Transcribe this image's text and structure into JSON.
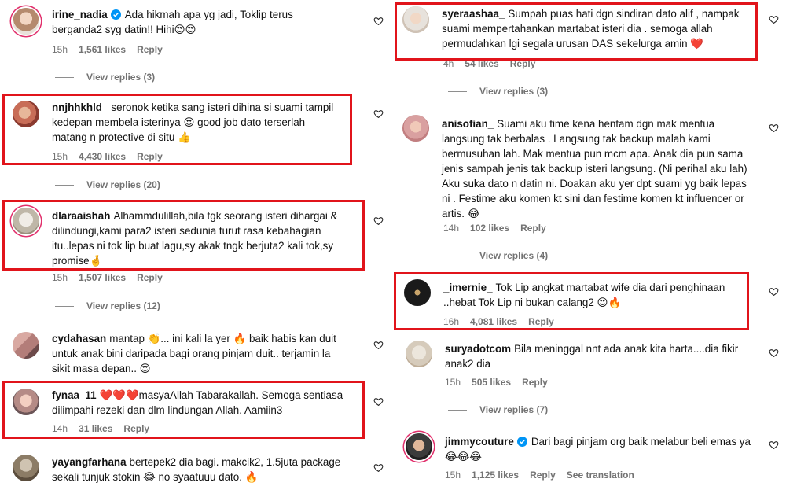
{
  "left": [
    {
      "user": "irine_nadia",
      "verified": true,
      "text": "Ada hikmah apa yg jadi, Toklip terus berganda2 syg datin!! Hihi😍😍",
      "time": "15h",
      "likes": "1,561 likes",
      "reply": "Reply",
      "view_replies": "View replies (3)"
    },
    {
      "user": "nnjhhkhld_",
      "verified": false,
      "text": "seronok ketika sang isteri dihina si suami tampil kedepan membela isterinya 😍 good job dato terserlah matang n protective di situ 👍",
      "time": "15h",
      "likes": "4,430 likes",
      "reply": "Reply",
      "view_replies": "View replies (20)"
    },
    {
      "user": "dlaraaishah",
      "verified": false,
      "text": "Alhammdulillah,bila tgk seorang isteri dihargai & dilindungi,kami para2 isteri sedunia turut rasa kebahagian itu..lepas ni tok lip buat lagu,sy akak tngk berjuta2 kali tok,sy promise🤞",
      "time": "15h",
      "likes": "1,507 likes",
      "reply": "Reply",
      "view_replies": "View replies (12)"
    },
    {
      "user": "cydahasan",
      "verified": false,
      "text": "mantap 👏... ini kali la yer 🔥 baik habis kan duit untuk anak bini daripada bagi orang pinjam duit.. terjamin la sikit masa depan.. 😍",
      "time": "",
      "likes": "",
      "reply": "",
      "view_replies": ""
    },
    {
      "user": "fynaa_11",
      "verified": false,
      "text": "❤️❤️❤️masyaAllah Tabarakallah. Semoga sentiasa dilimpahi rezeki dan dlm lindungan Allah. Aamiin3",
      "time": "14h",
      "likes": "31 likes",
      "reply": "Reply",
      "view_replies": ""
    },
    {
      "user": "yayangfarhana",
      "verified": false,
      "text": "bertepek2 dia bagi. makcik2, 1.5juta package sekali tunjuk stokin 😂 no syaatuuu dato. 🔥",
      "time": "",
      "likes": "",
      "reply": "",
      "view_replies": ""
    }
  ],
  "right": [
    {
      "user": "syeraashaa_",
      "verified": false,
      "text": "Sumpah puas hati dgn sindiran dato alif , nampak suami mempertahankan martabat isteri dia . semoga allah permudahkan lgi segala urusan DAS sekelurga amin ❤️",
      "time": "4h",
      "likes": "54 likes",
      "reply": "Reply",
      "view_replies": "View replies (3)"
    },
    {
      "user": "anisofian_",
      "verified": false,
      "text": "Suami aku time kena hentam dgn mak mentua langsung tak berbalas . Langsung tak backup malah kami bermusuhan lah. Mak mentua pun mcm apa. Anak dia pun sama jenis sampah jenis tak backup isteri langsung. (Ni perihal aku lah) Aku suka dato n datin ni. Doakan aku yer dpt suami yg baik lepas ni . Festime aku komen kt sini dan festime komen kt influencer or artis. 😂",
      "time": "14h",
      "likes": "102 likes",
      "reply": "Reply",
      "view_replies": "View replies (4)"
    },
    {
      "user": "_imernie_",
      "verified": false,
      "text": "Tok Lip angkat martabat wife dia dari penghinaan ..hebat Tok Lip ni bukan calang2 😍🔥",
      "time": "16h",
      "likes": "4,081 likes",
      "reply": "Reply",
      "view_replies": ""
    },
    {
      "user": "suryadotcom",
      "verified": false,
      "text": "Bila meninggal nnt ada anak kita harta....dia fikir anak2 dia",
      "time": "15h",
      "likes": "505 likes",
      "reply": "Reply",
      "view_replies": "View replies (7)"
    },
    {
      "user": "jimmycouture",
      "verified": true,
      "text": "Dari bagi pinjam org baik melabur beli emas ya 😂😂😂",
      "time": "15h",
      "likes": "1,125 likes",
      "reply": "Reply",
      "see_translation": "See translation",
      "view_replies": ""
    }
  ],
  "colors": {
    "highlight": "#e1141b",
    "muted": "#737373",
    "verified": "#0095f6"
  }
}
